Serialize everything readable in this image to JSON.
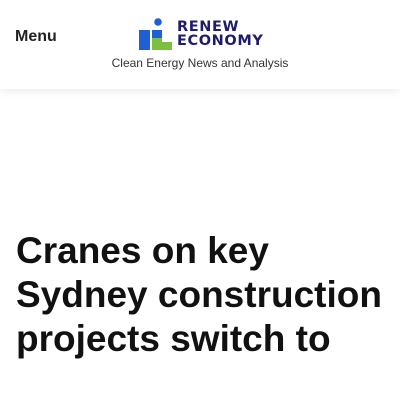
{
  "header": {
    "menu_label": "Menu",
    "logo": {
      "line1": "RENEW",
      "line2": "ECONOMY",
      "icon": "renew-economy-logo-icon",
      "colors": {
        "dot": "#1f5fd6",
        "bar_blue": "#1f5fd6",
        "bar_green": "#7bc043",
        "text": "#1f1d6b"
      }
    },
    "tagline": "Clean Energy News and Analysis"
  },
  "article": {
    "headline": "Cranes on key Sydney construction projects switch to"
  }
}
